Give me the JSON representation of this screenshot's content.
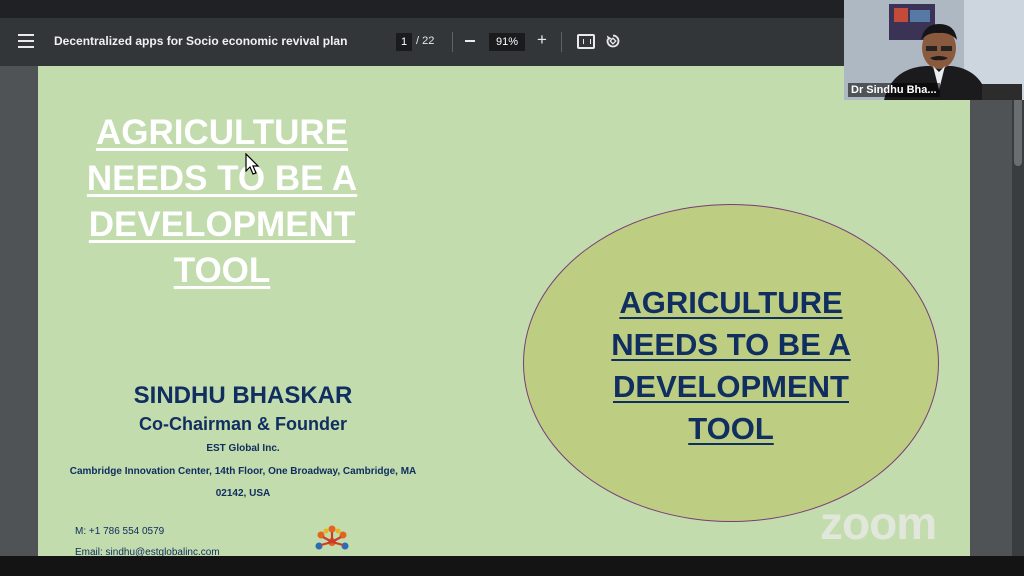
{
  "toolbar": {
    "title": "Decentralized apps for Socio economic revival plan",
    "current_page": "1",
    "total_pages": "/ 22",
    "zoom": "91%"
  },
  "slide": {
    "title": "AGRICULTURE NEEDS TO BE A DEVELOPMENT TOOL",
    "name": "SINDHU BHASKAR",
    "role": "Co-Chairman & Founder",
    "company": "EST Global Inc.",
    "address": "Cambridge Innovation Center, 14th Floor, One Broadway, Cambridge, MA  02142,  USA",
    "phone": "M: +1 786 554 0579",
    "email": "Email: sindhu@estglobalinc.com",
    "ellipse_text": "AGRICULTURE NEEDS TO BE A DEVELOPMENT TOOL",
    "ellipse_fill": "#bdce82",
    "page_bg": "#c2dcad",
    "text_navy": "#102e60"
  },
  "participant": {
    "name": "Dr Sindhu Bha..."
  },
  "watermark": "zoom"
}
